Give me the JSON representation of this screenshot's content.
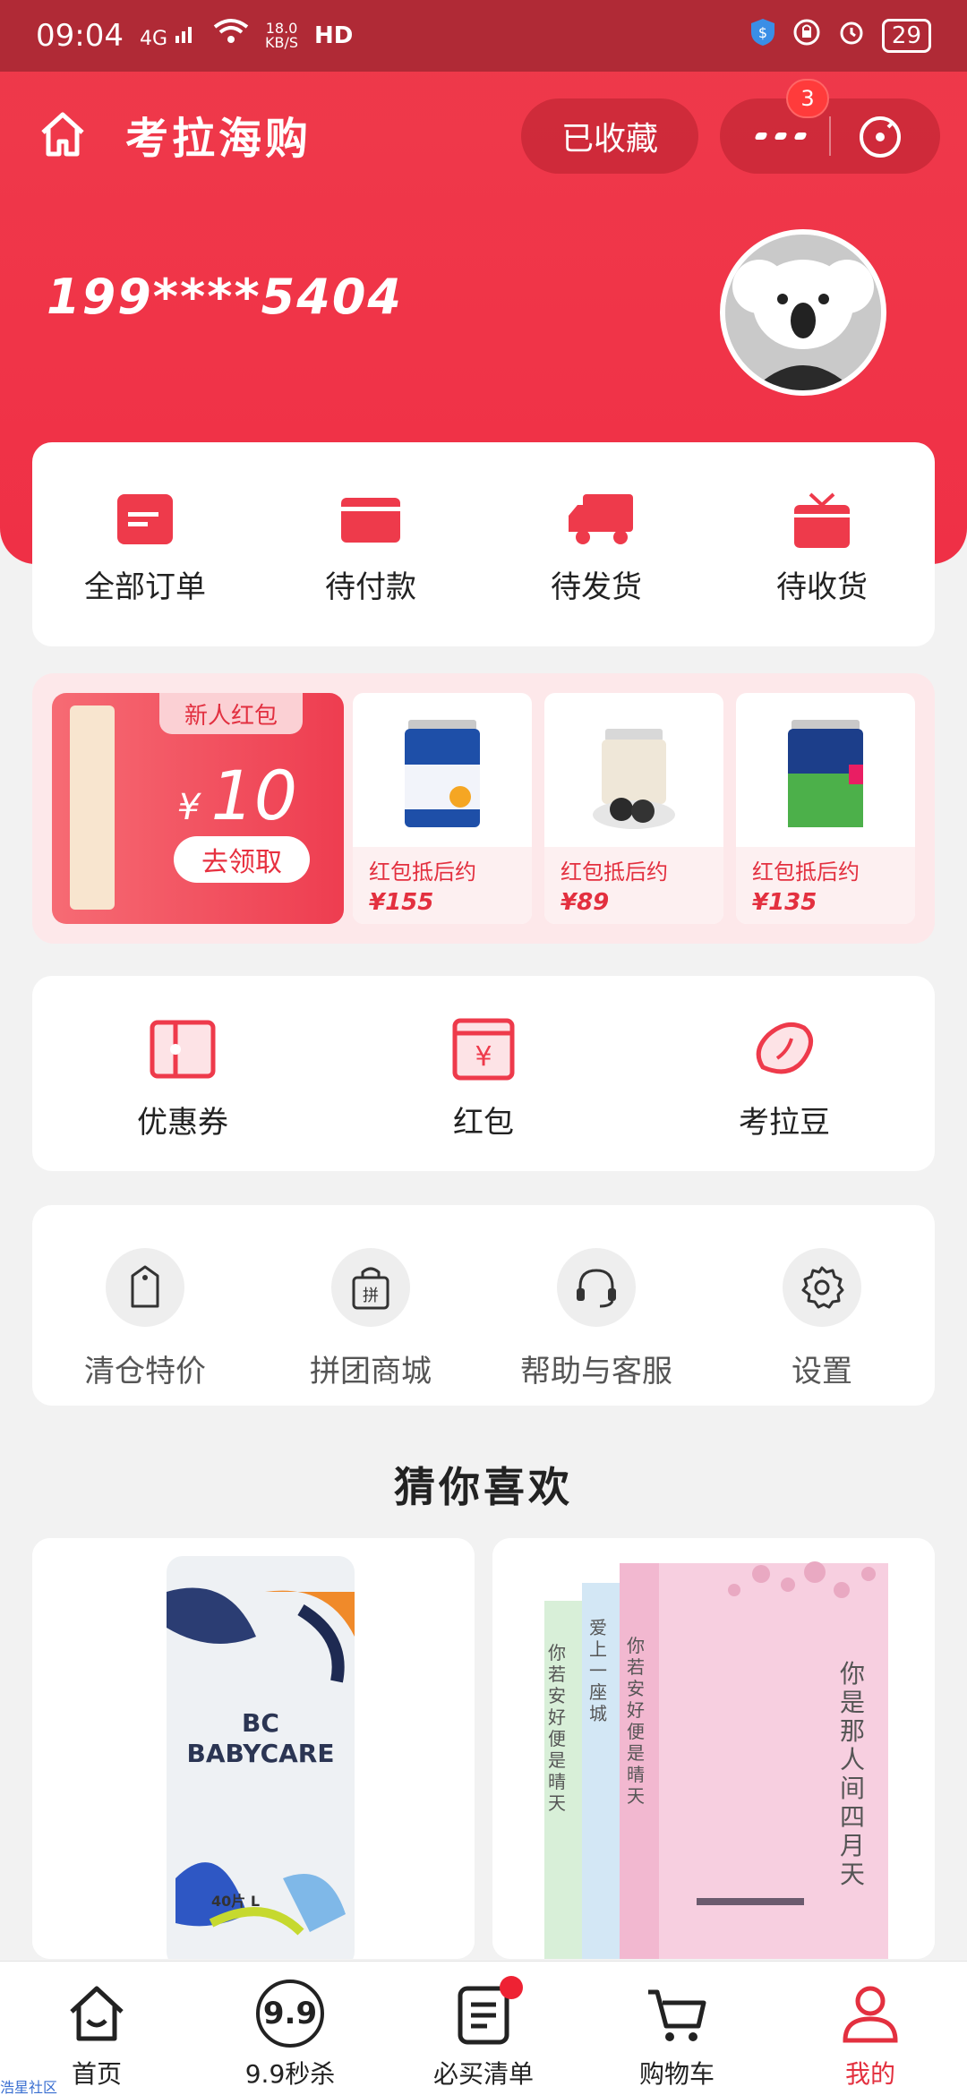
{
  "status_bar": {
    "time": "09:04",
    "network": "4G",
    "speed_value": "18.0",
    "speed_unit": "KB/S",
    "hd": "HD",
    "battery": "29"
  },
  "header": {
    "title": "考拉海购",
    "collect_label": "已收藏",
    "menu_badge": "3"
  },
  "user": {
    "phone": "199****5404"
  },
  "orders": {
    "items": [
      {
        "label": "全部订单",
        "icon": "order-list-icon"
      },
      {
        "label": "待付款",
        "icon": "wallet-card-icon"
      },
      {
        "label": "待发货",
        "icon": "truck-icon"
      },
      {
        "label": "待收货",
        "icon": "tv-box-icon"
      }
    ]
  },
  "promo": {
    "tag": "新人红包",
    "currency": "¥",
    "amount": "10",
    "get_label": "去领取",
    "products": [
      {
        "label": "红包抵后约",
        "price": "¥155"
      },
      {
        "label": "红包抵后约",
        "price": "¥89"
      },
      {
        "label": "红包抵后约",
        "price": "¥135"
      }
    ]
  },
  "assets": {
    "items": [
      {
        "label": "优惠券",
        "icon": "coupon-icon"
      },
      {
        "label": "红包",
        "icon": "red-envelope-icon"
      },
      {
        "label": "考拉豆",
        "icon": "bean-icon"
      }
    ]
  },
  "services": {
    "items": [
      {
        "label": "清仓特价",
        "icon": "price-tag-icon"
      },
      {
        "label": "拼团商城",
        "icon": "group-bag-icon"
      },
      {
        "label": "帮助与客服",
        "icon": "headset-icon"
      },
      {
        "label": "设置",
        "icon": "gear-icon"
      }
    ]
  },
  "guess": {
    "title": "猜你喜欢",
    "products": [
      {
        "brand_line1": "BC",
        "brand_line2": "BABYCARE",
        "size": "40片 L"
      },
      {
        "book_title": "你是那人间四月天",
        "book_title2": "爱上一座城",
        "book_title3": "你若安好便是晴天"
      }
    ]
  },
  "tabbar": {
    "items": [
      {
        "label": "首页",
        "icon": "home-icon"
      },
      {
        "label": "9.9秒杀",
        "icon": "sale-99-icon",
        "icon_text": "9.9"
      },
      {
        "label": "必买清单",
        "icon": "checklist-icon"
      },
      {
        "label": "购物车",
        "icon": "cart-icon"
      },
      {
        "label": "我的",
        "icon": "profile-icon"
      }
    ]
  },
  "watermark": "浩星社区",
  "colors": {
    "brand_red": "#ee3a4b",
    "accent_red": "#e3303f"
  }
}
